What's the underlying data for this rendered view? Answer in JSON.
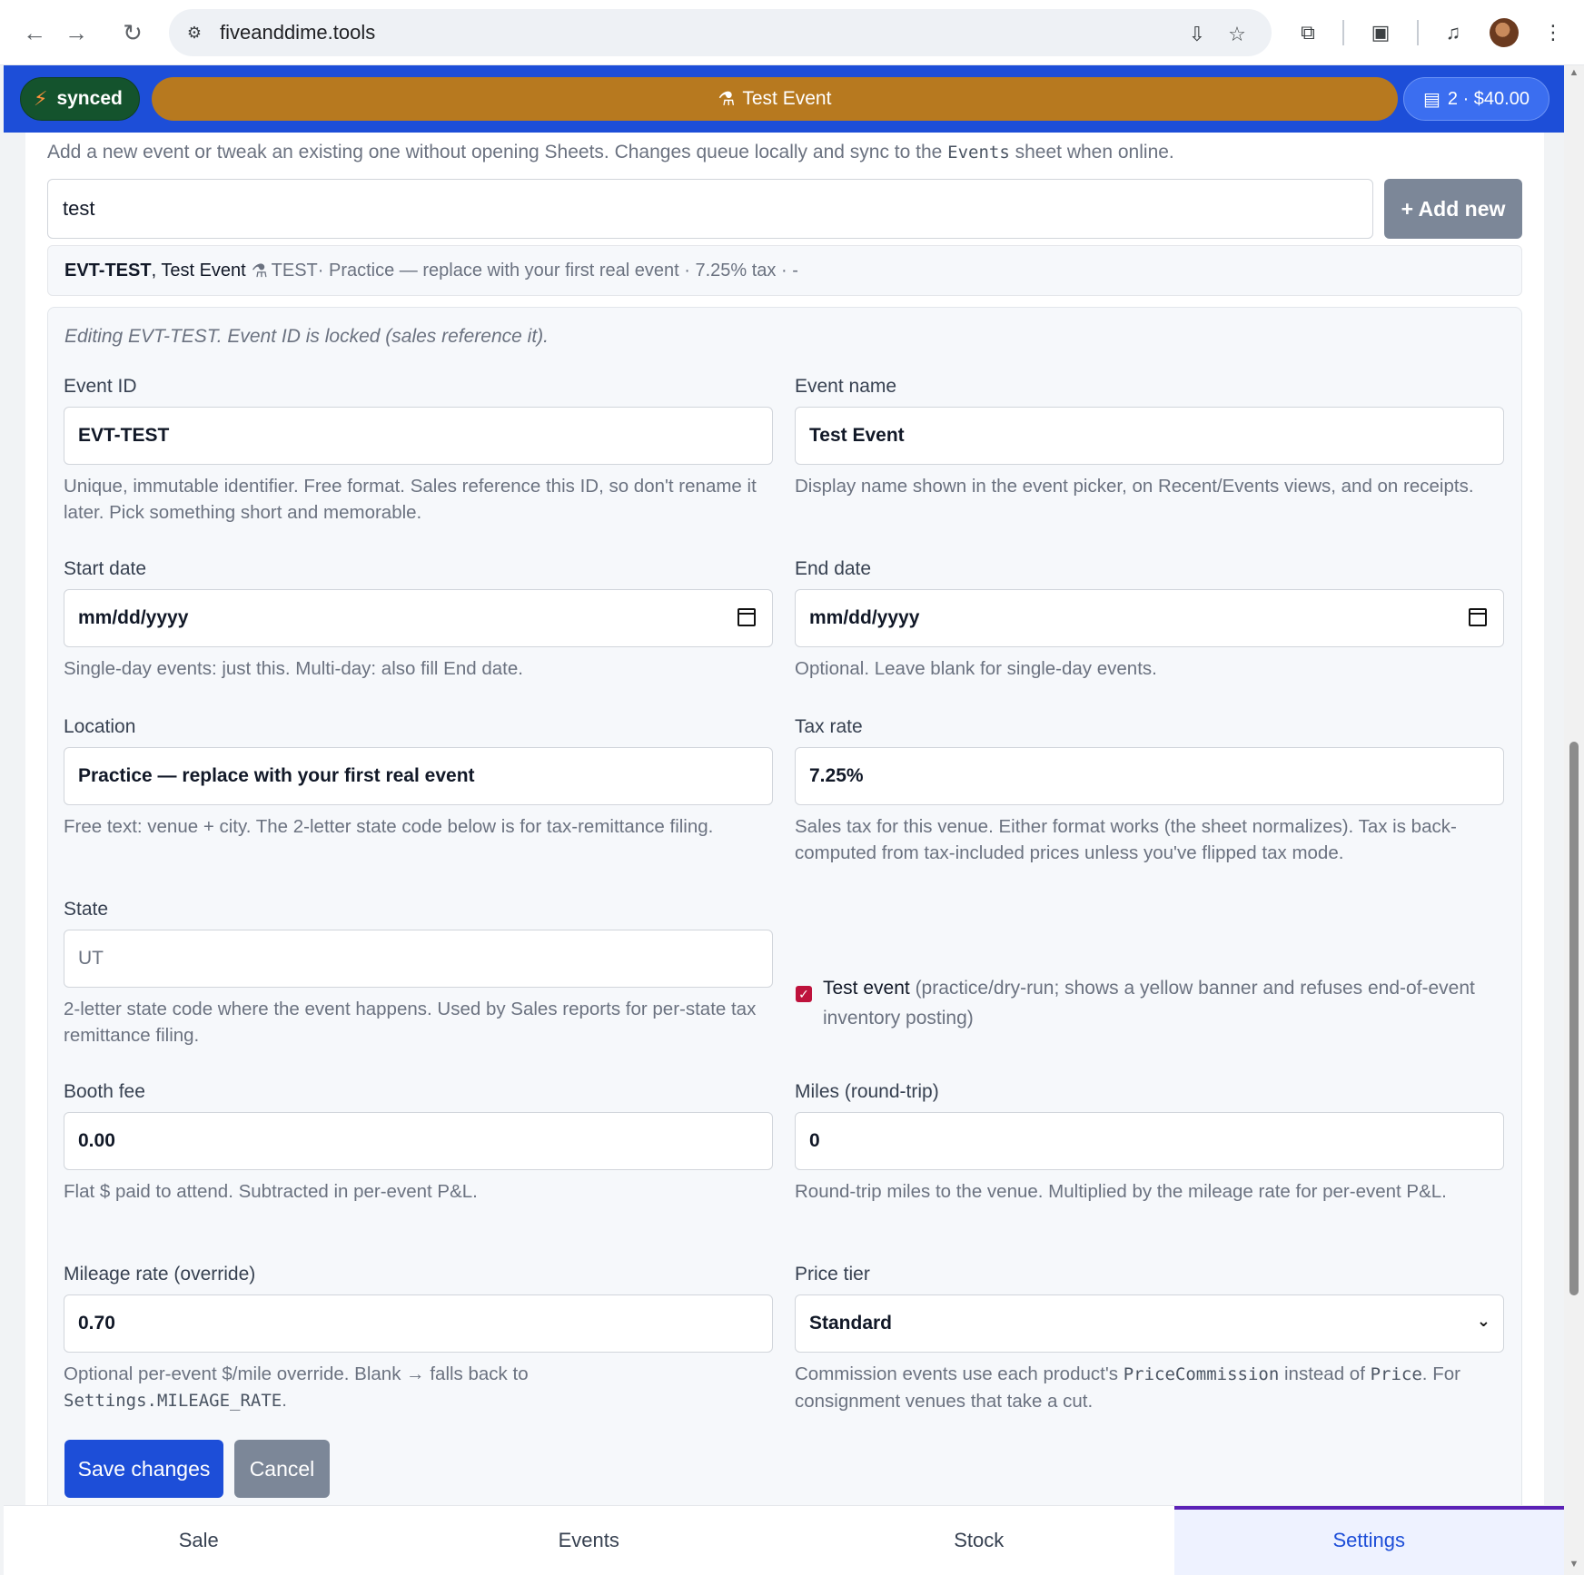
{
  "browser": {
    "url": "fiveanddime.tools"
  },
  "topbar": {
    "sync_label": "synced",
    "event_label": "Test Event",
    "cart_label": "2 · $40.00"
  },
  "events_editor": {
    "intro_before": "Add a new event or tweak an existing one without opening Sheets. Changes queue locally and sync to the ",
    "intro_code": "Events",
    "intro_after": " sheet when online.",
    "search_value": "test",
    "add_new_label": "+ Add new",
    "result": {
      "id": "EVT-TEST",
      "name": ", Test Event",
      "tag": "TEST",
      "details": " · Practice — replace with your first real event · 7.25% tax · -"
    },
    "edit_note": "Editing EVT-TEST. Event ID is locked (sales reference it).",
    "fields": {
      "event_id": {
        "label": "Event ID",
        "value": "EVT-TEST",
        "help": "Unique, immutable identifier. Free format. Sales reference this ID, so don't rename it later. Pick something short and memorable."
      },
      "event_name": {
        "label": "Event name",
        "value": "Test Event",
        "help": "Display name shown in the event picker, on Recent/Events views, and on receipts."
      },
      "start_date": {
        "label": "Start date",
        "value": "mm/dd/yyyy",
        "help": "Single-day events: just this. Multi-day: also fill End date."
      },
      "end_date": {
        "label": "End date",
        "value": "mm/dd/yyyy",
        "help": "Optional. Leave blank for single-day events."
      },
      "location": {
        "label": "Location",
        "value": "Practice — replace with your first real event",
        "help": "Free text: venue + city. The 2-letter state code below is for tax-remittance filing."
      },
      "tax_rate": {
        "label": "Tax rate",
        "value": "7.25%",
        "help": "Sales tax for this venue. Either format works (the sheet normalizes). Tax is back-computed from tax-included prices unless you've flipped tax mode."
      },
      "state": {
        "label": "State",
        "placeholder": "UT",
        "help": "2-letter state code where the event happens. Used by Sales reports for per-state tax remittance filing."
      },
      "test_event": {
        "checked": true,
        "label": "Test event",
        "help": " (practice/dry-run; shows a yellow banner and refuses end-of-event inventory posting)"
      },
      "booth_fee": {
        "label": "Booth fee",
        "value": "0.00",
        "help": "Flat $ paid to attend. Subtracted in per-event P&L."
      },
      "miles": {
        "label": "Miles (round-trip)",
        "value": "0",
        "help": "Round-trip miles to the venue. Multiplied by the mileage rate for per-event P&L."
      },
      "mileage_rate": {
        "label": "Mileage rate (override)",
        "value": "0.70",
        "help_before": "Optional per-event $/mile override. Blank → falls back to ",
        "help_code": "Settings.MILEAGE_RATE",
        "help_after": "."
      },
      "price_tier": {
        "label": "Price tier",
        "value": "Standard",
        "help_before": "Commission events use each product's ",
        "help_code1": "PriceCommission",
        "help_mid": " instead of ",
        "help_code2": "Price",
        "help_after": ". For consignment venues that take a cut."
      }
    },
    "save_label": "Save changes",
    "cancel_label": "Cancel"
  },
  "tabs": [
    {
      "label": "Sale",
      "active": false
    },
    {
      "label": "Events",
      "active": false
    },
    {
      "label": "Stock",
      "active": false
    },
    {
      "label": "Settings",
      "active": true
    }
  ],
  "colors": {
    "topbar": "#1d4ed8",
    "event_pill": "#b7791f",
    "synced_pill": "#14532d",
    "primary_button": "#1d4ed8",
    "secondary_button": "#7c8798",
    "checkbox": "#be123c"
  },
  "icons": [
    "back-arrow-icon",
    "forward-arrow-icon",
    "reload-icon",
    "site-info-icon",
    "install-icon",
    "star-icon",
    "extensions-icon",
    "tab-search-icon",
    "media-icon",
    "menu-icon",
    "bolt-icon",
    "test-flask-icon",
    "cart-icon",
    "calendar-icon",
    "chevron-down-icon",
    "check-icon"
  ]
}
